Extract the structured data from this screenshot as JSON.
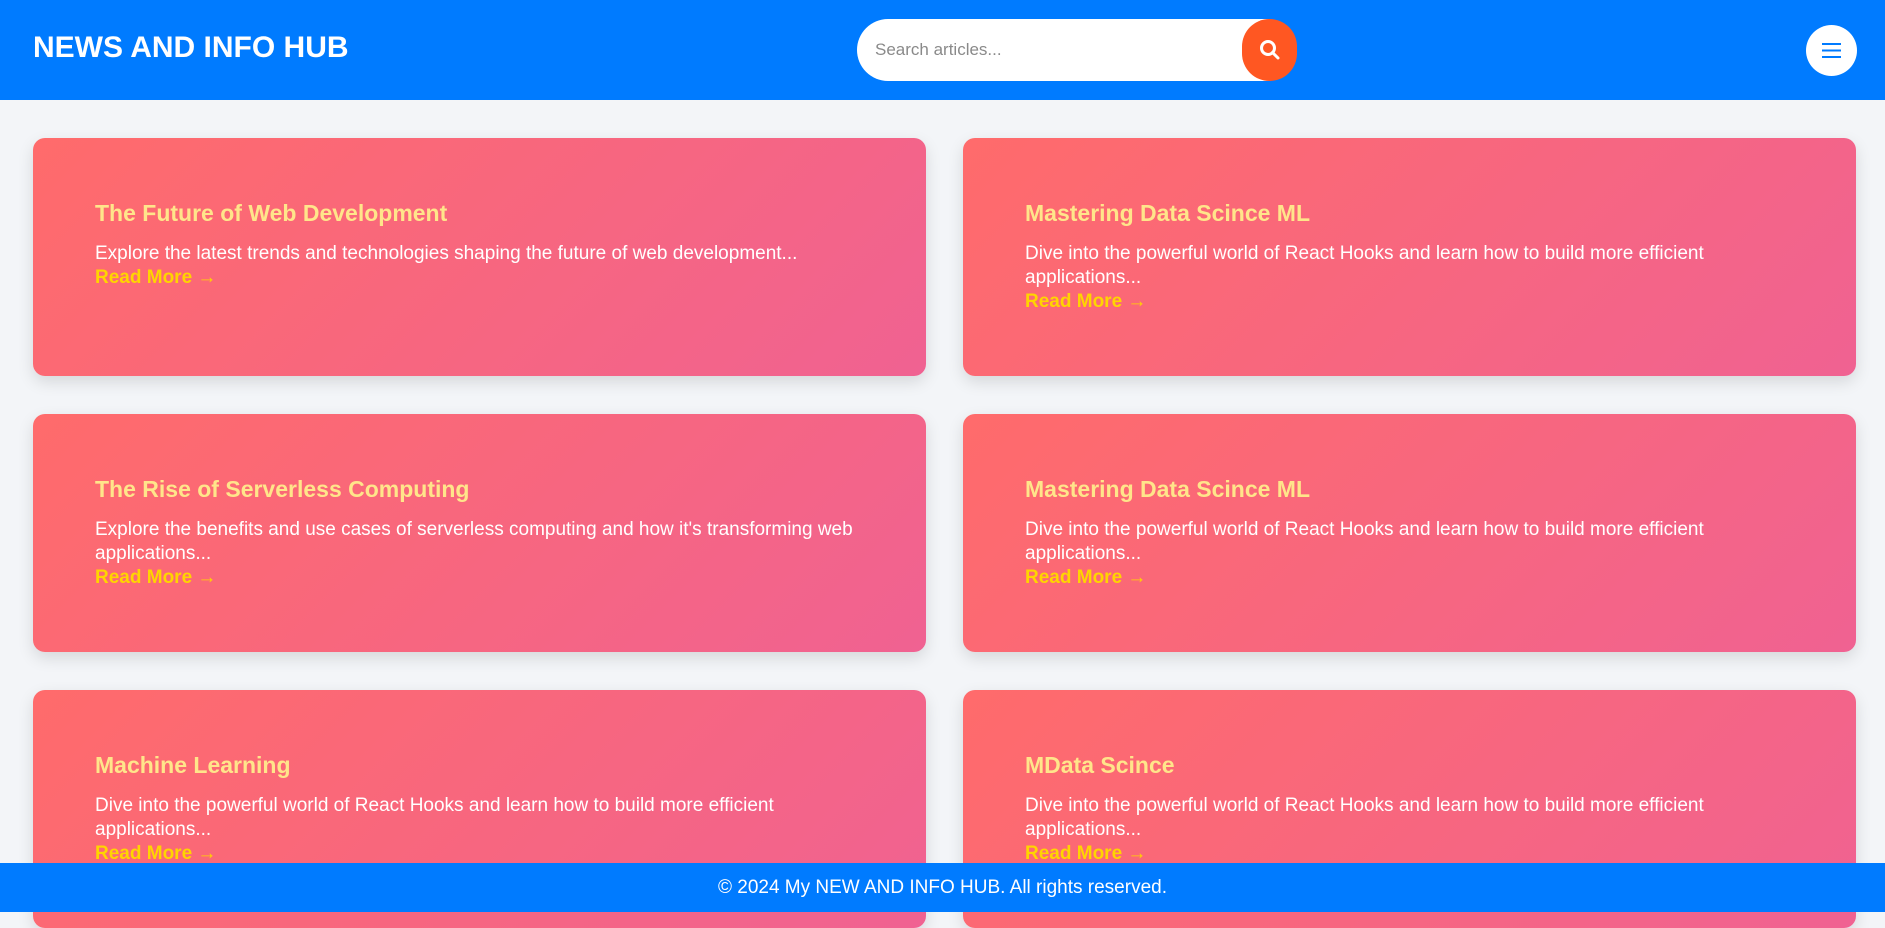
{
  "header": {
    "title": "NEWS AND INFO HUB",
    "search_placeholder": "Search articles...",
    "search_icon": "search-icon",
    "menu_icon": "hamburger-menu-icon"
  },
  "articles": [
    {
      "title": "The Future of Web Development",
      "description": "Explore the latest trends and technologies shaping the future of web development...",
      "read_more": "Read More →"
    },
    {
      "title": "Mastering Data Scince ML",
      "description": "Dive into the powerful world of React Hooks and learn how to build more efficient applications...",
      "read_more": "Read More →"
    },
    {
      "title": "The Rise of Serverless Computing",
      "description": "Explore the benefits and use cases of serverless computing and how it's transforming web applications...",
      "read_more": "Read More →"
    },
    {
      "title": "Mastering Data Scince ML",
      "description": "Dive into the powerful world of React Hooks and learn how to build more efficient applications...",
      "read_more": "Read More →"
    },
    {
      "title": "Machine Learning",
      "description": "Dive into the powerful world of React Hooks and learn how to build more efficient applications...",
      "read_more": "Read More →"
    },
    {
      "title": "MData Scince",
      "description": "Dive into the powerful world of React Hooks and learn how to build more efficient applications...",
      "read_more": "Read More →"
    }
  ],
  "footer": {
    "text": "© 2024 My NEW AND INFO HUB. All rights reserved."
  },
  "colors": {
    "header_bg": "#007bff",
    "search_button": "#ff5722",
    "card_gradient_start": "#ff6b6b",
    "card_gradient_end": "#f06292",
    "card_title": "#ffe58a",
    "read_more": "#ffd400"
  }
}
